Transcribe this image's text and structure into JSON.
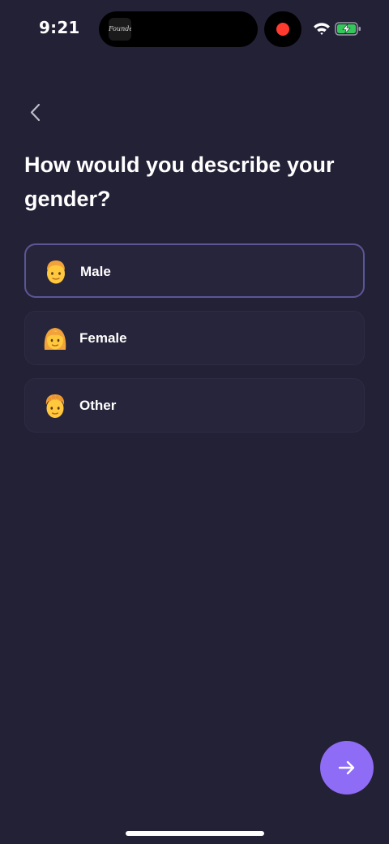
{
  "status_bar": {
    "time": "9:21",
    "island_app_label": "Founders",
    "recording_color": "#ff3b30",
    "icons": [
      "wifi-icon",
      "battery-charging-icon"
    ]
  },
  "header": {
    "back_icon": "chevron-left-icon"
  },
  "question": "How would you describe your gender?",
  "options": [
    {
      "label": "Male",
      "icon": "man-emoji-icon",
      "selected": true
    },
    {
      "label": "Female",
      "icon": "woman-emoji-icon",
      "selected": false
    },
    {
      "label": "Other",
      "icon": "person-emoji-icon",
      "selected": false
    }
  ],
  "next_button": {
    "icon": "arrow-right-icon",
    "color": "#8e6cf5"
  },
  "colors": {
    "background": "#232136",
    "card": "#27253b",
    "selected_border": "#5c5696",
    "accent": "#8e6cf5"
  }
}
